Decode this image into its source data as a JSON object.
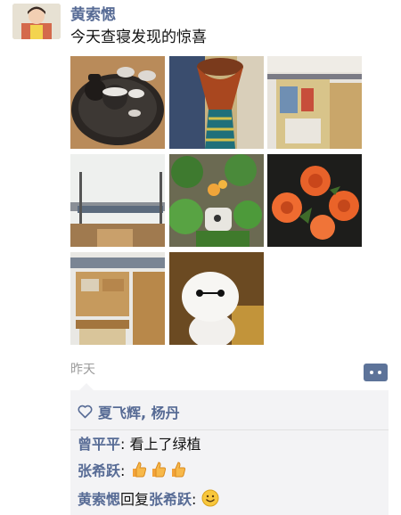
{
  "post": {
    "author": "黄索愢",
    "text": "今天查寝发现的惊喜",
    "photos": [
      {
        "icon": "tea-set-icon"
      },
      {
        "icon": "drum-icon"
      },
      {
        "icon": "dorm-shelf-icon"
      },
      {
        "icon": "bunk-bed-icon"
      },
      {
        "icon": "potted-plants-icon"
      },
      {
        "icon": "orange-roses-icon"
      },
      {
        "icon": "dorm-desk-icon"
      },
      {
        "icon": "baymax-figure-icon"
      }
    ],
    "timestamp": "昨天"
  },
  "likes": {
    "names": "夏飞辉, 杨丹"
  },
  "comments": [
    {
      "name": "曾平平",
      "sep": ": ",
      "text": "看上了绿植"
    },
    {
      "name": "张希跃",
      "sep": ": ",
      "emoji": "thumbs-up-icon x3"
    },
    {
      "name": "黄索愢",
      "reply_word": "回复",
      "reply_to": "张希跃",
      "sep": ": ",
      "emoji": "smile-icon"
    }
  ],
  "colors": {
    "name_blue": "#576b95",
    "box_bg": "#f3f3f5",
    "button_bg": "#5d7399"
  }
}
